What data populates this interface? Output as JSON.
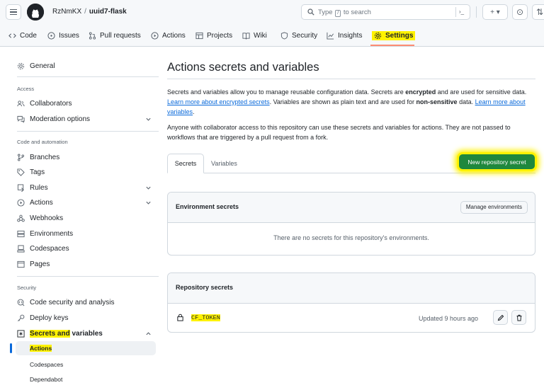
{
  "header": {
    "owner": "RzNmKX",
    "separator": "/",
    "repo": "uuid7-flask",
    "search_prefix": "Type",
    "search_key": "/",
    "search_suffix": "to search",
    "command_glyph": "›_",
    "plus_glyph": "+ ▾",
    "issues_glyph": "⊙",
    "pr_glyph": "⇅"
  },
  "tabs": [
    {
      "label": "Code",
      "icon": "code-icon"
    },
    {
      "label": "Issues",
      "icon": "issue-opened-icon"
    },
    {
      "label": "Pull requests",
      "icon": "git-pull-request-icon"
    },
    {
      "label": "Actions",
      "icon": "play-icon"
    },
    {
      "label": "Projects",
      "icon": "table-icon"
    },
    {
      "label": "Wiki",
      "icon": "book-icon"
    },
    {
      "label": "Security",
      "icon": "shield-icon"
    },
    {
      "label": "Insights",
      "icon": "graph-icon"
    },
    {
      "label": "Settings",
      "icon": "gear-icon",
      "active": true
    }
  ],
  "sidebar": {
    "general": "General",
    "access_heading": "Access",
    "collaborators": "Collaborators",
    "moderation": "Moderation options",
    "code_heading": "Code and automation",
    "branches": "Branches",
    "tags": "Tags",
    "rules": "Rules",
    "actions": "Actions",
    "webhooks": "Webhooks",
    "environments": "Environments",
    "codespaces": "Codespaces",
    "pages": "Pages",
    "security_heading": "Security",
    "code_security": "Code security and analysis",
    "deploy_keys": "Deploy keys",
    "secrets_a": "Secrets and",
    "secrets_b": "variables",
    "sub_actions": "Actions",
    "sub_codespaces": "Codespaces",
    "sub_dependabot": "Dependabot"
  },
  "main": {
    "title": "Actions secrets and variables",
    "p1_a": "Secrets and variables allow you to manage reusable configuration data. Secrets are ",
    "p1_b": "encrypted",
    "p1_c": " and are used for sensitive data. ",
    "p1_link1": "Learn more about encrypted secrets",
    "p1_d": ". Variables are shown as plain text and are used for ",
    "p1_e": "non-sensitive",
    "p1_f": " data. ",
    "p1_link2": "Learn more about variables",
    "p1_g": ".",
    "p2": "Anyone with collaborator access to this repository can use these secrets and variables for actions. They are not passed to workflows that are triggered by a pull request from a fork.",
    "tab_secrets": "Secrets",
    "tab_variables": "Variables",
    "new_secret_button": "New repository secret",
    "env_title": "Environment secrets",
    "manage_env_button": "Manage environments",
    "env_empty": "There are no secrets for this repository's environments.",
    "repo_title": "Repository secrets",
    "secret_name": "CF_TOKEN",
    "secret_updated": "Updated 9 hours ago"
  },
  "colors": {
    "accent_green": "#1f883d",
    "link_blue": "#0969da",
    "highlight_yellow": "#fff200",
    "tab_underline": "#fd8c73"
  }
}
